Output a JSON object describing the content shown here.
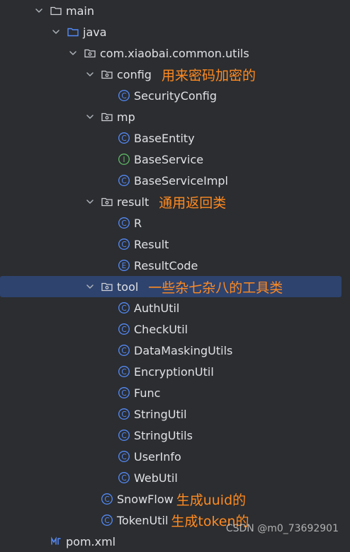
{
  "colors": {
    "background": "#2b2d30",
    "text": "#dfe1e5",
    "annotation": "#ff8a21",
    "selection": "#2e436e",
    "class_icon": "#548af7",
    "interface_icon": "#5fb865"
  },
  "tree": [
    {
      "label": "main",
      "kind": "folder",
      "expanded": true,
      "depth": 0,
      "icon": "folder-icon"
    },
    {
      "label": "java",
      "kind": "source-folder",
      "expanded": true,
      "depth": 1,
      "icon": "source-folder-icon"
    },
    {
      "label": "com.xiaobai.common.utils",
      "kind": "package",
      "expanded": true,
      "depth": 2,
      "icon": "package-icon"
    },
    {
      "label": "config",
      "kind": "package",
      "expanded": true,
      "depth": 3,
      "icon": "package-icon",
      "note": "用来密码加密的"
    },
    {
      "label": "SecurityConfig",
      "kind": "class",
      "depth": 4,
      "icon": "class-icon"
    },
    {
      "label": "mp",
      "kind": "package",
      "expanded": true,
      "depth": 3,
      "icon": "package-icon"
    },
    {
      "label": "BaseEntity",
      "kind": "class",
      "depth": 4,
      "icon": "class-icon"
    },
    {
      "label": "BaseService",
      "kind": "interface",
      "depth": 4,
      "icon": "interface-icon"
    },
    {
      "label": "BaseServiceImpl",
      "kind": "class",
      "depth": 4,
      "icon": "class-icon"
    },
    {
      "label": "result",
      "kind": "package",
      "expanded": true,
      "depth": 3,
      "icon": "package-icon",
      "note": "通用返回类"
    },
    {
      "label": "R",
      "kind": "class",
      "depth": 4,
      "icon": "class-icon"
    },
    {
      "label": "Result",
      "kind": "class",
      "depth": 4,
      "icon": "class-icon"
    },
    {
      "label": "ResultCode",
      "kind": "enum",
      "depth": 4,
      "icon": "enum-icon"
    },
    {
      "label": "tool",
      "kind": "package",
      "expanded": true,
      "depth": 3,
      "icon": "package-icon",
      "note": "一些杂七杂八的工具类",
      "selected": true
    },
    {
      "label": "AuthUtil",
      "kind": "class",
      "depth": 4,
      "icon": "class-icon"
    },
    {
      "label": "CheckUtil",
      "kind": "class",
      "depth": 4,
      "icon": "class-icon"
    },
    {
      "label": "DataMaskingUtils",
      "kind": "class",
      "depth": 4,
      "icon": "class-icon"
    },
    {
      "label": "EncryptionUtil",
      "kind": "class",
      "depth": 4,
      "icon": "class-icon"
    },
    {
      "label": "Func",
      "kind": "class",
      "depth": 4,
      "icon": "class-icon"
    },
    {
      "label": "StringUtil",
      "kind": "class",
      "depth": 4,
      "icon": "class-icon"
    },
    {
      "label": "StringUtils",
      "kind": "class",
      "depth": 4,
      "icon": "class-icon"
    },
    {
      "label": "UserInfo",
      "kind": "class",
      "depth": 4,
      "icon": "class-icon"
    },
    {
      "label": "WebUtil",
      "kind": "class",
      "depth": 4,
      "icon": "class-icon"
    },
    {
      "label": "SnowFlow",
      "kind": "class",
      "depth": 3,
      "icon": "class-icon",
      "note": "生成uuid的"
    },
    {
      "label": "TokenUtil",
      "kind": "class",
      "depth": 3,
      "icon": "class-icon",
      "note": "生成token的"
    },
    {
      "label": "pom.xml",
      "kind": "maven",
      "depth": 0,
      "icon": "maven-file-icon"
    }
  ],
  "watermark": "CSDN @m0_73692901"
}
